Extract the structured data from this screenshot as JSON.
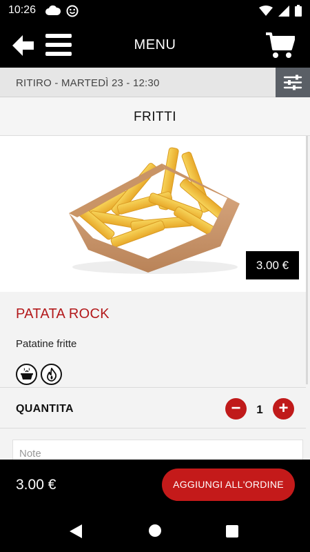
{
  "status_bar": {
    "time": "10:26",
    "left_icons": [
      "cloud-icon",
      "smiley-icon"
    ],
    "right_icons": [
      "wifi-icon",
      "signal-icon",
      "battery-icon"
    ]
  },
  "app_bar": {
    "title": "MENU",
    "icons": [
      "back-arrow-icon",
      "hamburger-menu-icon",
      "cart-icon"
    ]
  },
  "pickup": {
    "text": "RITIRO - MARTEDÌ 23 - 12:30",
    "filter_icon": "sliders-icon"
  },
  "category": {
    "title": "FRITTI"
  },
  "product": {
    "image": "french-fries-in-paper-tray",
    "price_tag": "3.00 €",
    "name": "PATATA ROCK",
    "description": "Patatine fritte",
    "attribute_icons": [
      "cooking-pot-icon",
      "flame-icon"
    ]
  },
  "quantity": {
    "label": "QUANTITA",
    "value": "1",
    "minus": "−",
    "plus": "+"
  },
  "note": {
    "placeholder": "Note"
  },
  "footer": {
    "total": "3.00 €",
    "add_button": "AGGIUNGI ALL'ORDINE"
  },
  "nav_bar": {
    "icons": [
      "nav-back-icon",
      "nav-home-icon",
      "nav-recents-icon"
    ]
  },
  "colors": {
    "accent_red": "#c41a1a",
    "product_name_red": "#b3191b",
    "filter_button_gray": "#5a5f66"
  }
}
